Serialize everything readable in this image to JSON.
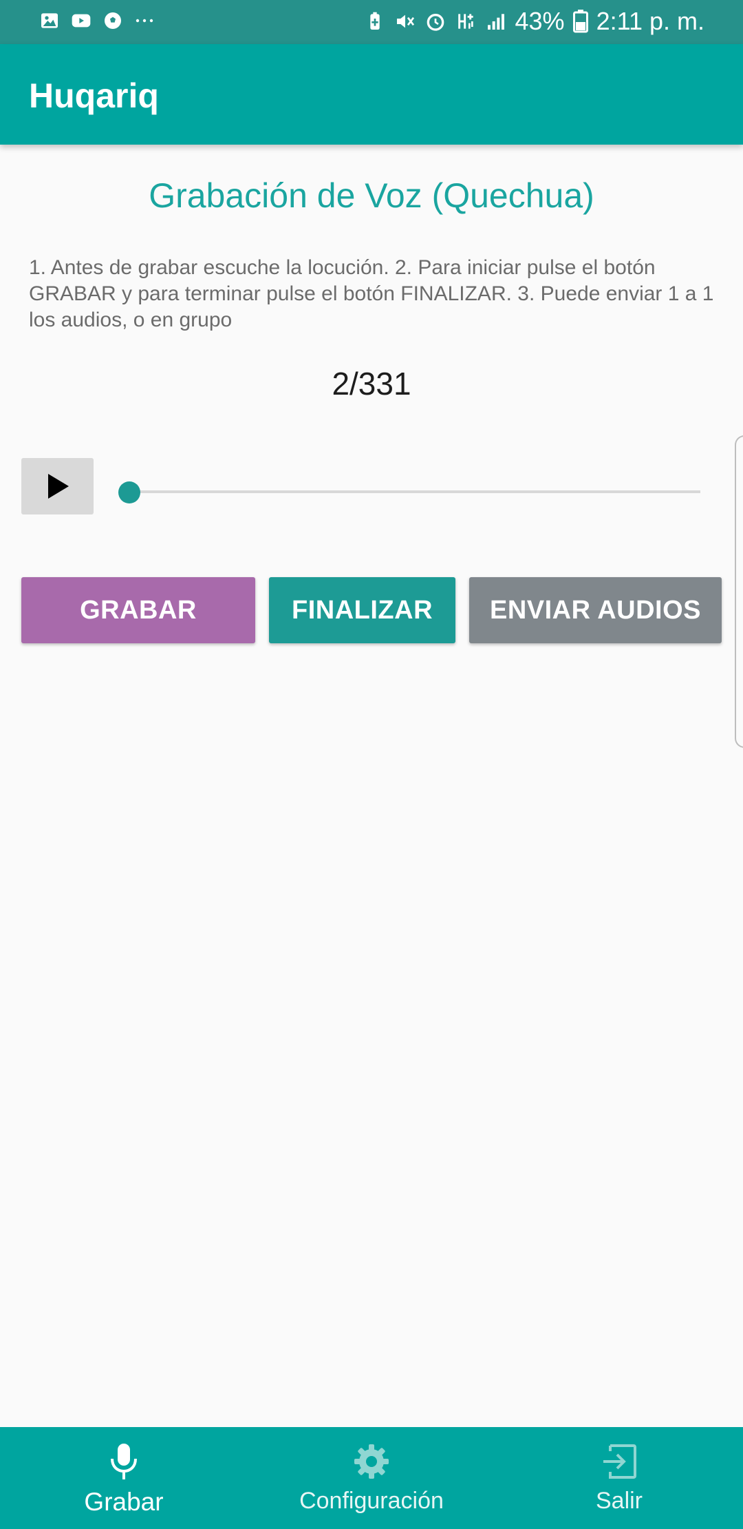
{
  "status_bar": {
    "icons_left": [
      "gallery-icon",
      "youtube-icon",
      "soccer-ball-icon",
      "more-dots-icon"
    ],
    "icons_right": [
      "battery-saver-icon",
      "mute-icon",
      "alarm-icon",
      "network-type-icon",
      "signal-icon"
    ],
    "battery": "43%",
    "time": "2:11 p. m."
  },
  "app_bar": {
    "title": "Huqariq"
  },
  "main": {
    "heading": "Grabación de Voz (Quechua)",
    "instructions": "1.  Antes de grabar escuche la locución. 2. Para iniciar pulse el botón GRABAR y para terminar pulse el botón FINALIZAR. 3. Puede enviar 1 a 1 los audios, o en grupo",
    "counter": "2/331",
    "player": {
      "play_icon": "play-icon",
      "progress": 0
    },
    "buttons": {
      "record_label": "Grabar",
      "finish_label": "Finalizar",
      "send_label": "Enviar audios"
    }
  },
  "bottom_nav": {
    "items": [
      {
        "label": "Grabar",
        "icon": "microphone-icon",
        "selected": true
      },
      {
        "label": "Configuración",
        "icon": "gear-icon",
        "selected": false
      },
      {
        "label": "Salir",
        "icon": "logout-icon",
        "selected": false
      }
    ]
  },
  "colors": {
    "primary": "#00a59f",
    "status_bar": "#26918b",
    "heading": "#1aa5a0",
    "record_button": "#a86aab",
    "finish_button": "#1d9b95",
    "send_button": "#80878c"
  }
}
